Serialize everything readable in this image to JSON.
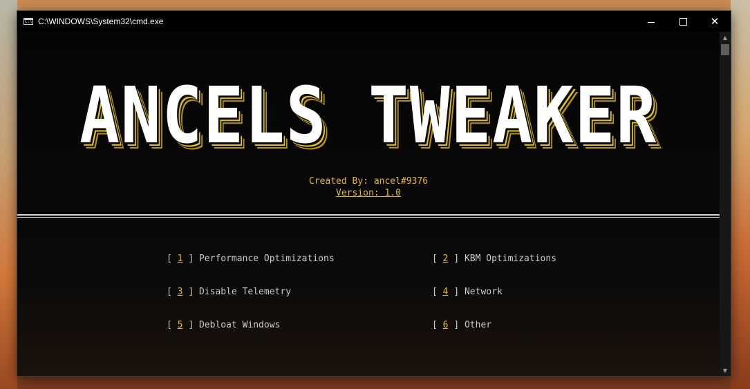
{
  "window": {
    "title": "C:\\WINDOWS\\System32\\cmd.exe",
    "icon_text": "C:\\",
    "controls": {
      "minimize": "minimize-icon",
      "maximize": "maximize-icon",
      "close": "✕"
    }
  },
  "console": {
    "banner": "ANCELS TWEAKER",
    "created_by": "Created By: ancel#9376",
    "version": "Version: 1.0",
    "options": [
      {
        "number": "1",
        "label": "Performance Optimizations"
      },
      {
        "number": "2",
        "label": "KBM Optimizations"
      },
      {
        "number": "3",
        "label": "Disable Telemetry"
      },
      {
        "number": "4",
        "label": "Network"
      },
      {
        "number": "5",
        "label": "Debloat Windows"
      },
      {
        "number": "6",
        "label": "Other"
      }
    ],
    "bracket_open": "[",
    "bracket_close": "]"
  },
  "scrollbar": {
    "up": "▲",
    "down": "▼"
  },
  "colors": {
    "accent": "#e6b825",
    "text": "#cccccc",
    "background": "#0c0c0c"
  }
}
